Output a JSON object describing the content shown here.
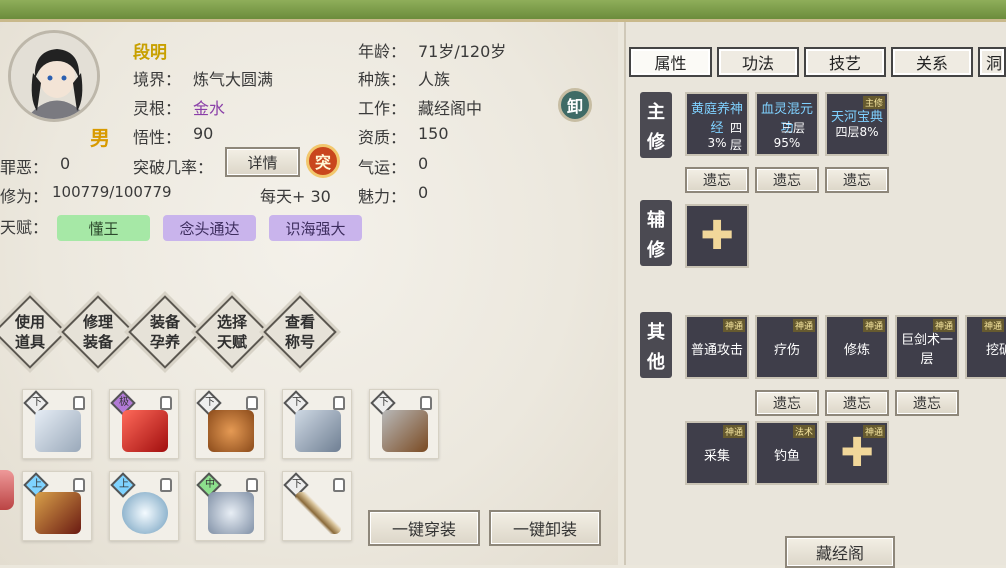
{
  "character": {
    "name": "段明",
    "gender": "男",
    "realm_label": "境界：",
    "realm": "炼气大圆满",
    "root_label": "灵根：",
    "root": "金水",
    "insight_label": "悟性：",
    "insight": "90",
    "sin_label": "罪恶：",
    "sin": "0",
    "breakthrough_label": "突破几率：",
    "detail_button": "详情",
    "break_icon": "突",
    "cultivation_label": "修为：",
    "cultivation": "100779/100779",
    "daily": "每天+ 30",
    "age_label": "年龄：",
    "age": "71岁/120岁",
    "race_label": "种族：",
    "race": "人族",
    "job_label": "工作：",
    "job": "藏经阁中",
    "aptitude_label": "资质：",
    "aptitude": "150",
    "luck_label": "气运：",
    "luck": "0",
    "charm_label": "魅力：",
    "charm": "0",
    "unequip_icon": "卸",
    "talent_label": "天赋：",
    "talents": [
      "懂王",
      "念头通达",
      "识海强大"
    ]
  },
  "actions": [
    "使用道具",
    "修理装备",
    "装备孕养",
    "选择天赋",
    "查看称号"
  ],
  "equipment": {
    "row1_grades": [
      "下",
      "极",
      "下",
      "下",
      "下"
    ],
    "row2_grades": [
      "上",
      "上",
      "中",
      "下"
    ],
    "equip_all": "一键穿装",
    "unequip_all": "一键卸装"
  },
  "tabs": [
    "属性",
    "功法",
    "技艺",
    "关系",
    "洞"
  ],
  "skills": {
    "main_label": "主修",
    "main": [
      {
        "name": "黄庭养神经",
        "level": "四层",
        "progress": "3%"
      },
      {
        "name": "血灵混元功",
        "level": "三层",
        "progress": "95%"
      },
      {
        "name": "天河宝典",
        "level": "四层8%",
        "badge": "主修"
      }
    ],
    "forget_label": "遗忘",
    "aux_label": "辅修",
    "other_label": "其他",
    "other": [
      {
        "name": "普通攻击",
        "badge": "神通"
      },
      {
        "name": "疗伤",
        "badge": "神通"
      },
      {
        "name": "修炼",
        "badge": "神通"
      },
      {
        "name": "巨剑术一层",
        "badge": "神通"
      },
      {
        "name": "挖矿",
        "badge": "神通"
      },
      {
        "name": "采集",
        "badge": "神通"
      },
      {
        "name": "钓鱼",
        "badge": "法术"
      }
    ],
    "plus_badge": "神通",
    "library_button": "藏经阁"
  },
  "colors": {
    "talent_green": "#a6e8a6",
    "talent_purple": "#c9b4ec",
    "name": "#c8a000",
    "root": "#8a3fa8"
  }
}
